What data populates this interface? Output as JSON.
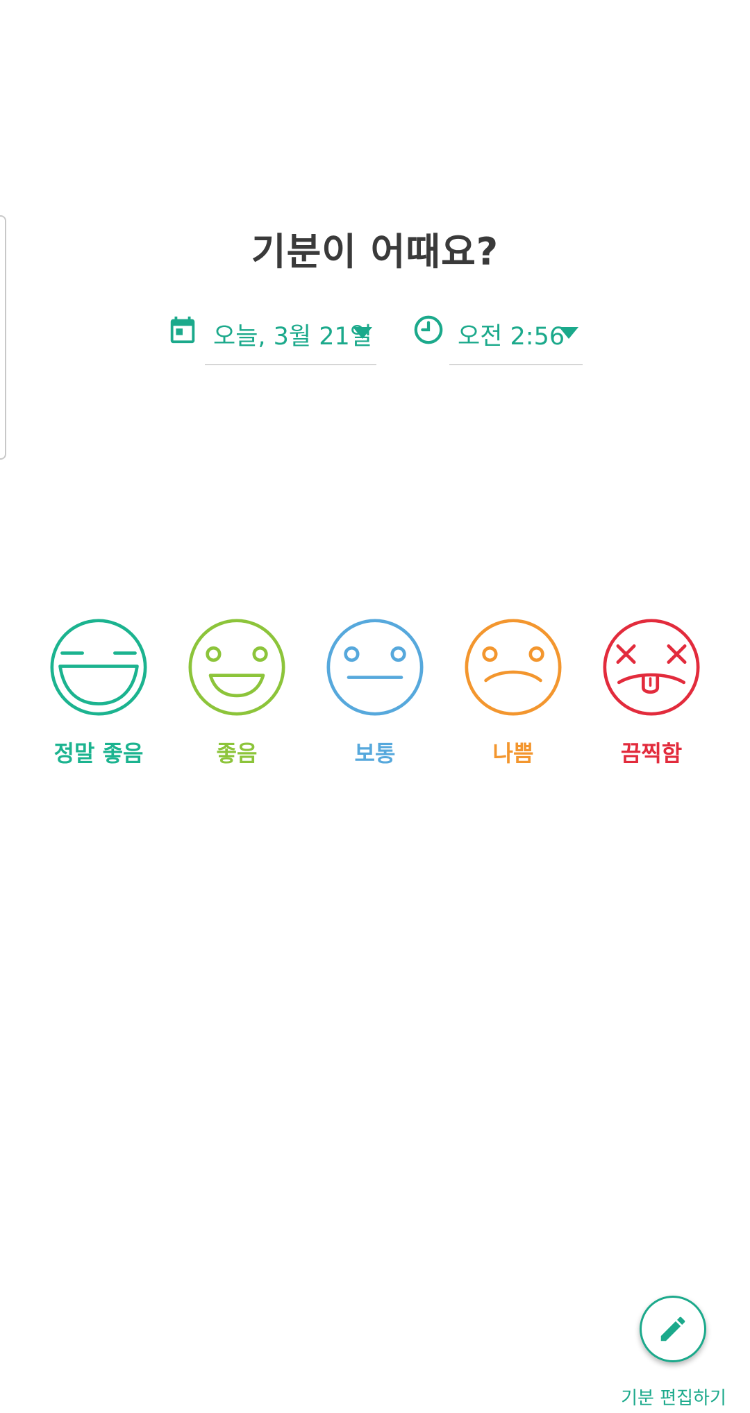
{
  "screen": {
    "title": "기분이 어때요?"
  },
  "date_picker": {
    "icon": "calendar-icon",
    "value": "오늘, 3월 21일"
  },
  "time_picker": {
    "icon": "clock-icon",
    "value": "오전 2:56"
  },
  "moods": [
    {
      "id": "great",
      "label": "정말 좋음",
      "color": "#1bb38f",
      "icon": "grinning-face-icon"
    },
    {
      "id": "good",
      "label": "좋음",
      "color": "#8cc43a",
      "icon": "smiling-face-icon"
    },
    {
      "id": "meh",
      "label": "보통",
      "color": "#56a8dc",
      "icon": "neutral-face-icon"
    },
    {
      "id": "bad",
      "label": "나쁨",
      "color": "#f3962e",
      "icon": "sad-face-icon"
    },
    {
      "id": "awful",
      "label": "끔찍함",
      "color": "#e22b3c",
      "icon": "dizzy-face-icon"
    }
  ],
  "fab": {
    "icon": "pencil-icon",
    "label": "기분 편집하기"
  },
  "colors": {
    "accent": "#1ba98b",
    "title_text": "#3a3a3a"
  }
}
